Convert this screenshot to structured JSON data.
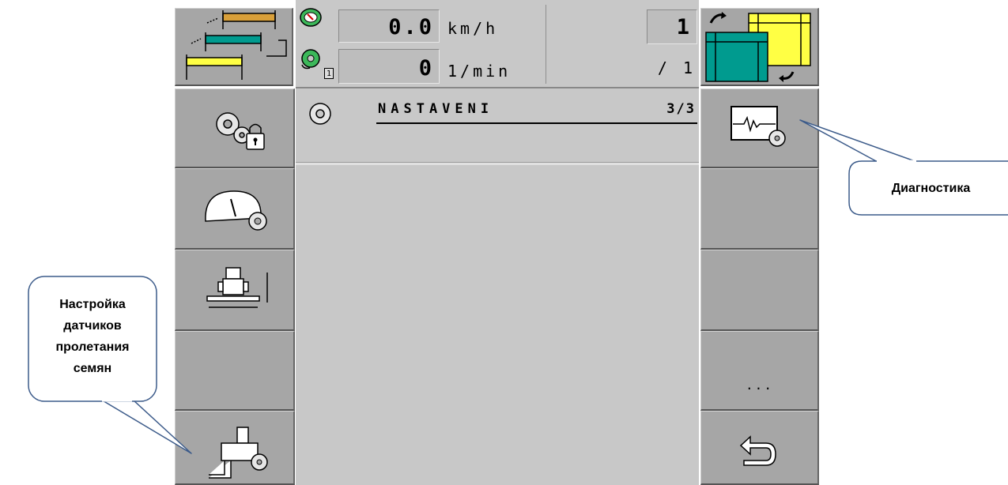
{
  "status_bar": {
    "speed_value": "0.0",
    "speed_unit": "km/h",
    "rpm_value": "0",
    "rpm_unit": "1/min",
    "rpm_sensor_index": "1",
    "counter_value": "1",
    "counter_total": "/ 1"
  },
  "main": {
    "title": "NASTAVENI",
    "page_indicator": "3/3"
  },
  "right_menu": {
    "more_label": "..."
  },
  "callouts": {
    "diagnostics": "Диагностика",
    "seed_sensor_setup": [
      "Настройка",
      "датчиков",
      "пролетания",
      "семян"
    ]
  },
  "colors": {
    "panel": "#c8c8c8",
    "button": "#a6a6a6",
    "teal": "#009b8f",
    "yellow": "#ffff44",
    "orange": "#d9a03a",
    "callout_border": "#3c5b8a"
  },
  "icons": {
    "top_left": "tramline-section-icon",
    "top_right": "headland-sections-icon",
    "left": [
      "settings-lock-icon",
      "speedometer-settings-icon",
      "implement-width-icon",
      null,
      "seed-sensor-settings-icon"
    ],
    "right": [
      "diagnostics-icon",
      null,
      null,
      "more-icon",
      "back-icon"
    ]
  }
}
